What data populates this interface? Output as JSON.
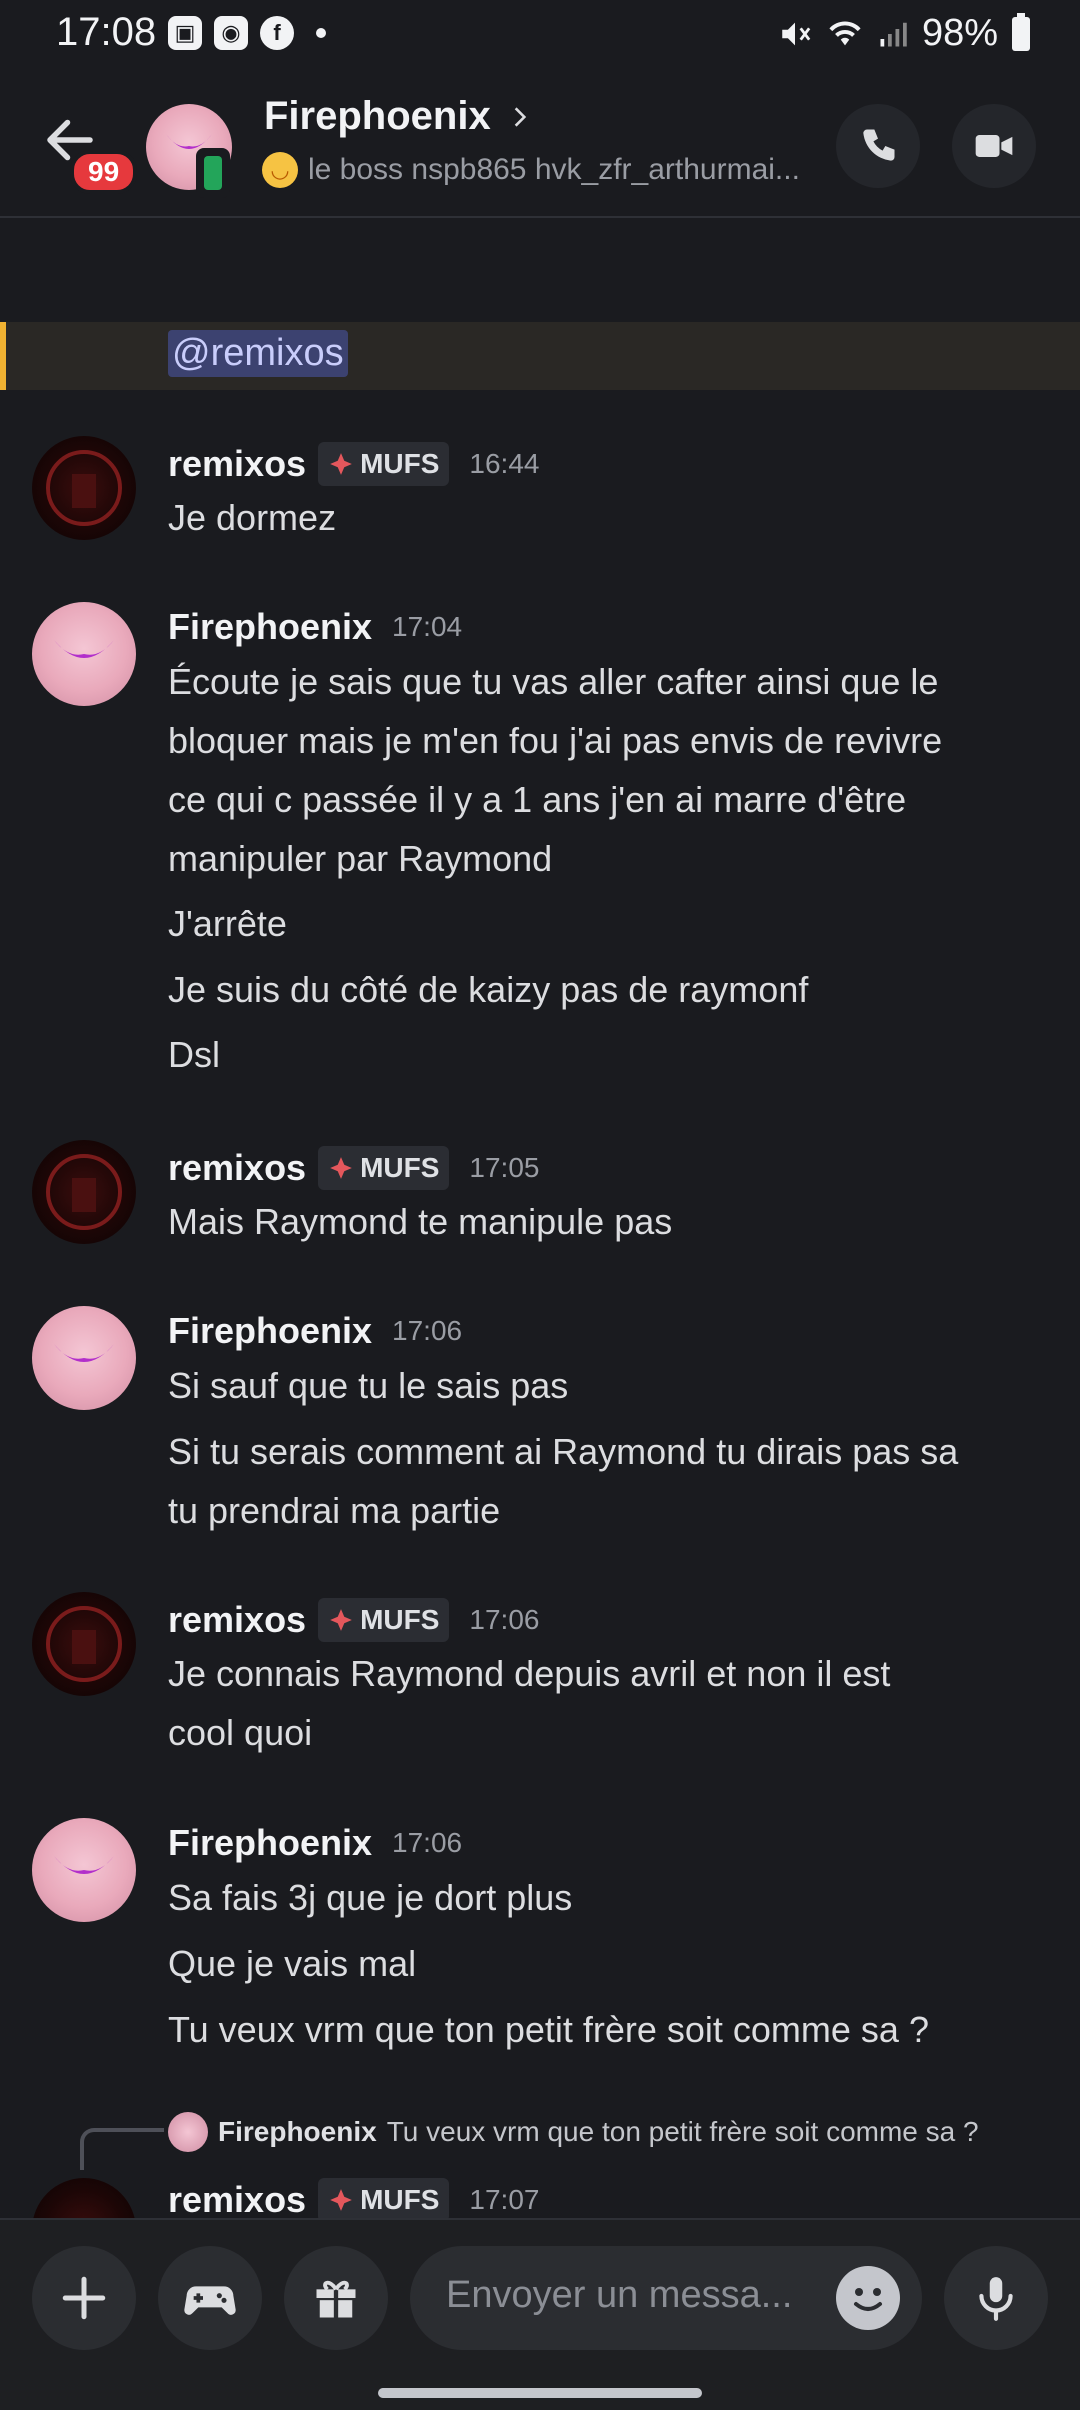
{
  "status_bar": {
    "time": "17:08",
    "battery": "98%"
  },
  "header": {
    "unread_badge": "99",
    "name": "Firephoenix",
    "status_text": "le boss nspb865 hvk_zfr_arthurmai..."
  },
  "mention": "@remixos",
  "role_tag": "MUFS",
  "messages": [
    {
      "author": "remixos",
      "has_tag": true,
      "time": "16:44",
      "lines": [
        "Je dormez"
      ]
    },
    {
      "author": "Firephoenix",
      "has_tag": false,
      "time": "17:04",
      "lines": [
        "Écoute je sais que tu vas aller cafter ainsi que le",
        "bloquer mais je m'en fou j'ai pas envis de revivre",
        "ce qui c passée il y a 1 ans  j'en ai marre d'être",
        "manipuler par Raymond",
        "J'arrête",
        "Je suis du côté de kaizy pas de raymonf",
        "Dsl"
      ]
    },
    {
      "author": "remixos",
      "has_tag": true,
      "time": "17:05",
      "lines": [
        "Mais Raymond te manipule pas"
      ]
    },
    {
      "author": "Firephoenix",
      "has_tag": false,
      "time": "17:06",
      "lines": [
        "Si sauf que tu le sais pas",
        "Si tu serais comment ai Raymond tu dirais pas sa",
        "tu prendrai ma partie"
      ]
    },
    {
      "author": "remixos",
      "has_tag": true,
      "time": "17:06",
      "lines": [
        "Je connais Raymond depuis avril et non il est",
        "cool quoi"
      ]
    },
    {
      "author": "Firephoenix",
      "has_tag": false,
      "time": "17:06",
      "lines": [
        "Sa fais 3j que je dort plus",
        "Que je vais mal",
        "Tu veux vrm que ton petit frère soit comme sa ?"
      ]
    }
  ],
  "reply": {
    "author": "Firephoenix",
    "text": "Tu veux vrm que ton petit frère soit comme sa ?"
  },
  "last_message": {
    "author": "remixos",
    "time": "17:07"
  },
  "composer": {
    "placeholder": "Envoyer un messa..."
  }
}
